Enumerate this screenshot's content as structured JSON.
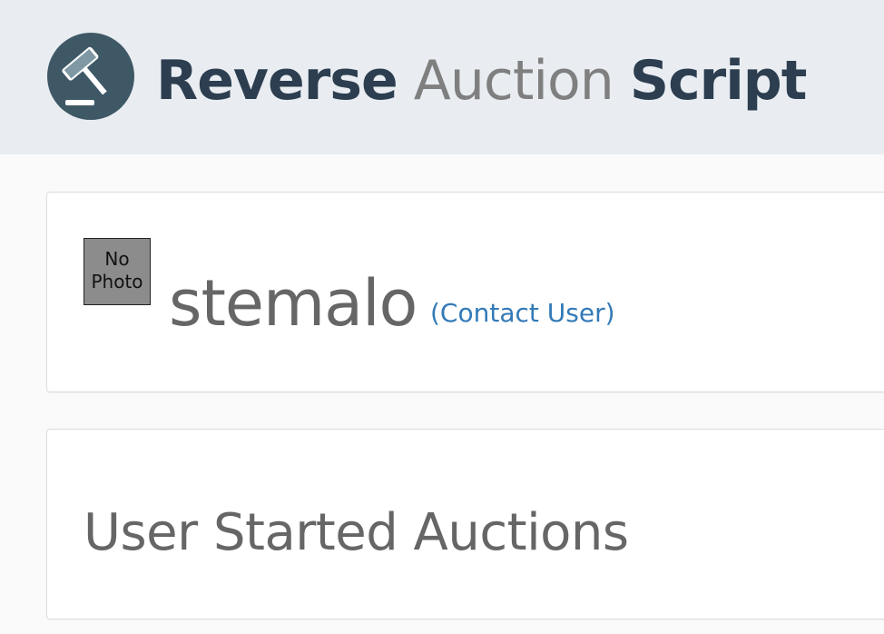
{
  "header": {
    "brand": {
      "word1": "Reverse",
      "word2": "Auction",
      "word3": "Script"
    },
    "logo_icon": "gavel-icon"
  },
  "profile": {
    "photo_placeholder_line1": "No",
    "photo_placeholder_line2": "Photo",
    "username": "stemalo",
    "contact_link_label": "(Contact User)"
  },
  "auctions": {
    "heading": "User Started Auctions"
  },
  "colors": {
    "header_bg": "#e9edf1",
    "brand_dark": "#2c3e50",
    "brand_gray": "#7f7f7f",
    "link_blue": "#337ab7",
    "text_gray": "#666666",
    "logo_circle": "#3f5866"
  }
}
